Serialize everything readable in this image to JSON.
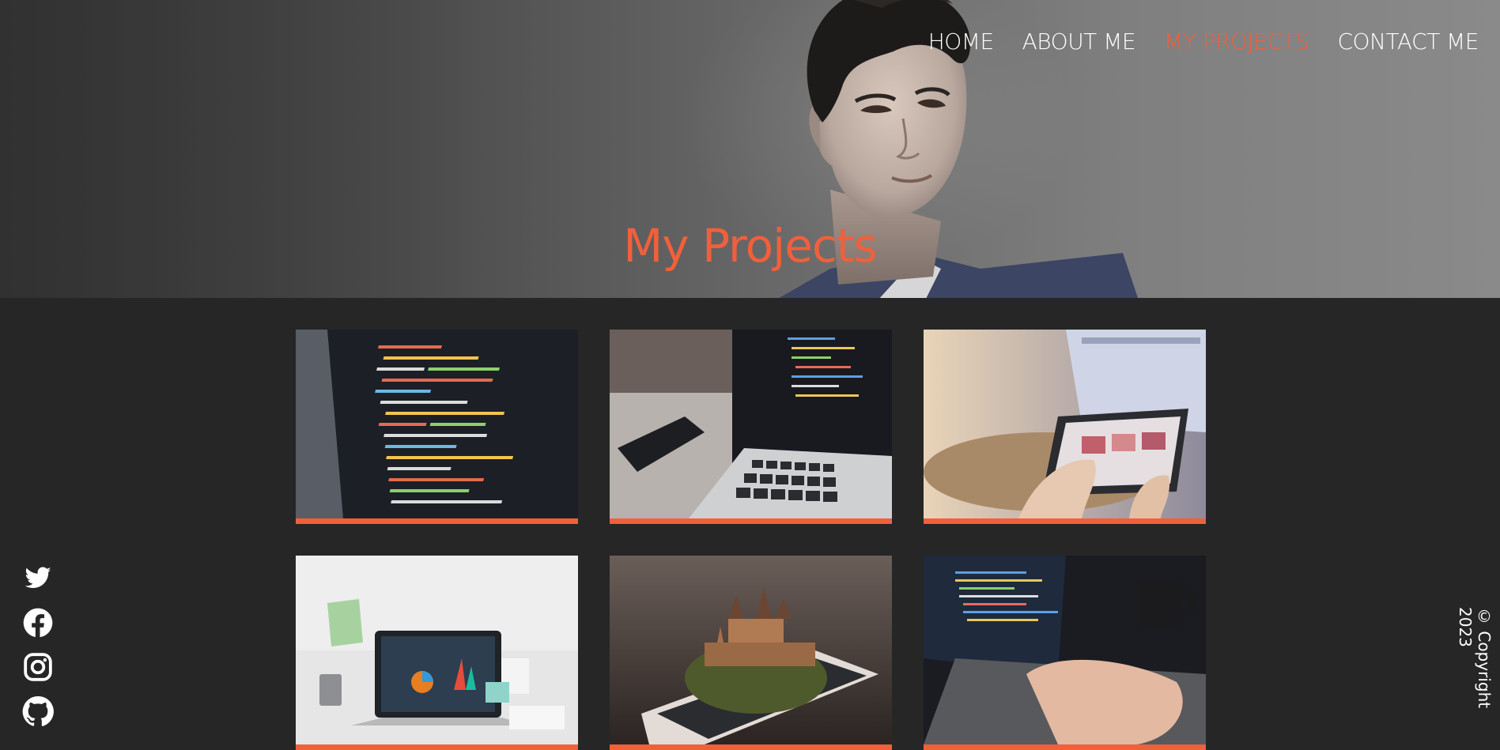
{
  "nav": {
    "items": [
      {
        "label": "HOME"
      },
      {
        "label": "ABOUT ME"
      },
      {
        "label": "MY PROJECTS",
        "active": true
      },
      {
        "label": "CONTACT ME"
      }
    ]
  },
  "hero": {
    "title": "My Projects"
  },
  "colors": {
    "accent": "#f0603a",
    "background": "#262626",
    "nav_text": "#ffffff"
  },
  "projects": [
    {
      "image": "code-editor-screen-photo"
    },
    {
      "image": "laptop-with-phone-code-photo"
    },
    {
      "image": "hands-tablet-laptop-photo"
    },
    {
      "image": "laptop-dashboard-charts-photo"
    },
    {
      "image": "phone-with-castle-photo"
    },
    {
      "image": "typing-laptop-mug-photo"
    }
  ],
  "social": [
    {
      "icon": "twitter-icon"
    },
    {
      "icon": "facebook-icon"
    },
    {
      "icon": "instagram-icon"
    },
    {
      "icon": "github-icon"
    }
  ],
  "footer": {
    "copyright": "© Copyright 2023"
  }
}
